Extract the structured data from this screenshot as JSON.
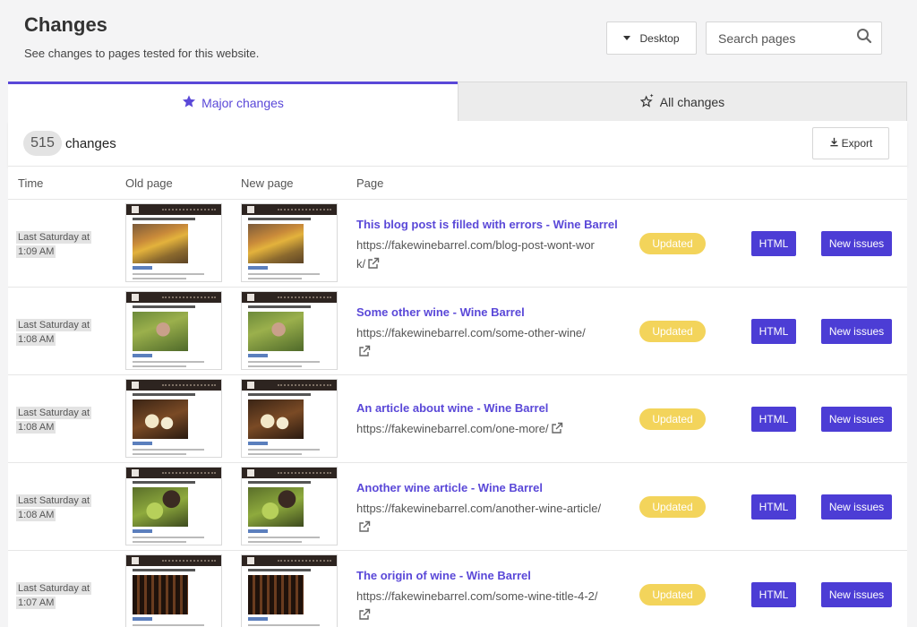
{
  "header": {
    "title": "Changes",
    "subtitle": "See changes to pages tested for this website.",
    "device_label": "Desktop",
    "search_placeholder": "Search pages"
  },
  "tabs": [
    {
      "label": "Major changes",
      "icon": "star-icon",
      "active": true
    },
    {
      "label": "All changes",
      "icon": "sparkle-star-icon",
      "active": false
    }
  ],
  "summary": {
    "count": "515",
    "count_label": "changes",
    "export_label": "Export"
  },
  "table": {
    "columns": [
      "Time",
      "Old page",
      "New page",
      "Page"
    ],
    "rows": [
      {
        "time_line1": "Last Saturday at",
        "time_line2": "1:09 AM",
        "title": "This blog post is filled with errors - Wine Barrel",
        "url_line1": "https://fakewinebarrel.com/blog-post-wont-wor",
        "url_line2": "k/",
        "status": "Updated",
        "html_label": "HTML",
        "issues_label": "New issues",
        "thumb": "vineyard"
      },
      {
        "time_line1": "Last Saturday at",
        "time_line2": "1:08 AM",
        "title": "Some other wine - Wine Barrel",
        "url_line1": "https://fakewinebarrel.com/some-other-wine/",
        "url_line2": "",
        "status": "Updated",
        "html_label": "HTML",
        "issues_label": "New issues",
        "thumb": "farmer"
      },
      {
        "time_line1": "Last Saturday at",
        "time_line2": "1:08 AM",
        "title": "An article about wine - Wine Barrel",
        "url_line1": "https://fakewinebarrel.com/one-more/",
        "url_line2": "",
        "status": "Updated",
        "html_label": "HTML",
        "issues_label": "New issues",
        "thumb": "glasses"
      },
      {
        "time_line1": "Last Saturday at",
        "time_line2": "1:08 AM",
        "title": "Another wine article - Wine Barrel",
        "url_line1": "https://fakewinebarrel.com/another-wine-article/",
        "url_line2": "",
        "status": "Updated",
        "html_label": "HTML",
        "issues_label": "New issues",
        "thumb": "grapes"
      },
      {
        "time_line1": "Last Saturday at",
        "time_line2": "1:07 AM",
        "title": "The origin of wine - Wine Barrel",
        "url_line1": "https://fakewinebarrel.com/some-wine-title-4-2/",
        "url_line2": "",
        "status": "Updated",
        "html_label": "HTML",
        "issues_label": "New issues",
        "thumb": "cellar"
      }
    ]
  },
  "colors": {
    "accent": "#5a48d8",
    "button": "#4c3dd5",
    "updated_badge": "#f3d45b"
  }
}
